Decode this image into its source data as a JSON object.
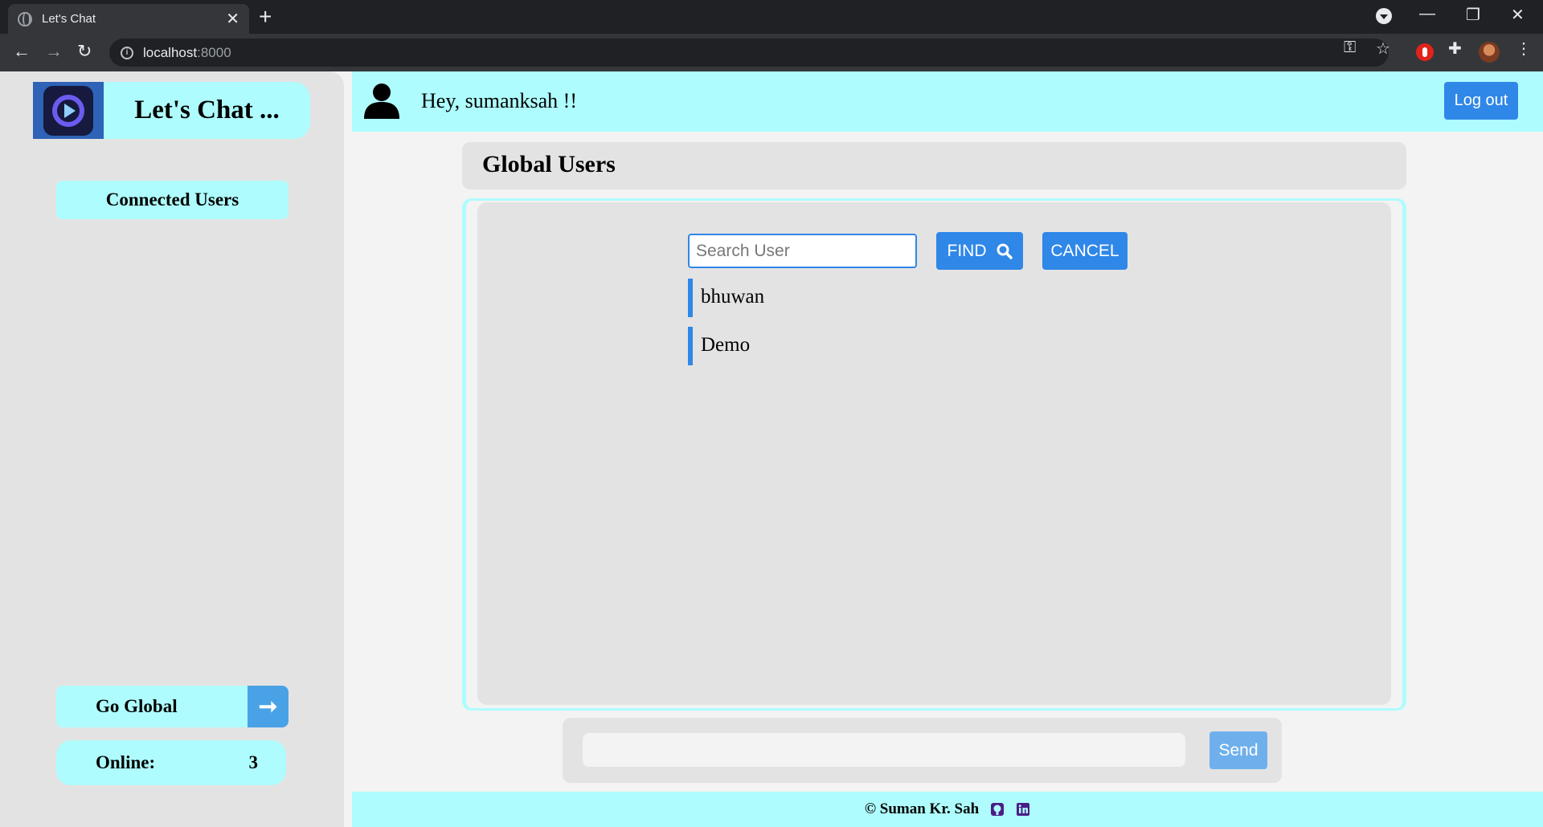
{
  "browser": {
    "tab_title": "Let's Chat",
    "close_glyph": "✕",
    "newtab_glyph": "+",
    "url_host": "localhost",
    "url_port": ":8000",
    "info_glyph": "i",
    "back_glyph": "←",
    "forward_glyph": "→",
    "reload_glyph": "↻",
    "minimize_glyph": "—",
    "restore_glyph": "❐",
    "window_close_glyph": "✕",
    "key_glyph": "⚿",
    "star_glyph": "☆",
    "puzzle_glyph": "✚",
    "menu_glyph": "⋮"
  },
  "sidebar": {
    "brand_title": "Let's Chat ...",
    "connected_users_label": "Connected Users",
    "go_global_label": "Go Global",
    "go_global_arrow": "➞",
    "online_label": "Online:",
    "online_count": "3"
  },
  "header": {
    "greeting": "Hey, sumanksah !!",
    "logout_label": "Log out"
  },
  "main": {
    "title": "Global Users",
    "search_placeholder": "Search User",
    "find_label": "FIND",
    "cancel_label": "CANCEL",
    "users": [
      "bhuwan",
      "Demo"
    ]
  },
  "composer": {
    "send_label": "Send"
  },
  "footer": {
    "credit": "© Suman Kr. Sah"
  },
  "colors": {
    "accent": "#2f87e8",
    "cyan": "#aefcfd",
    "panel": "#e4e3e3"
  }
}
